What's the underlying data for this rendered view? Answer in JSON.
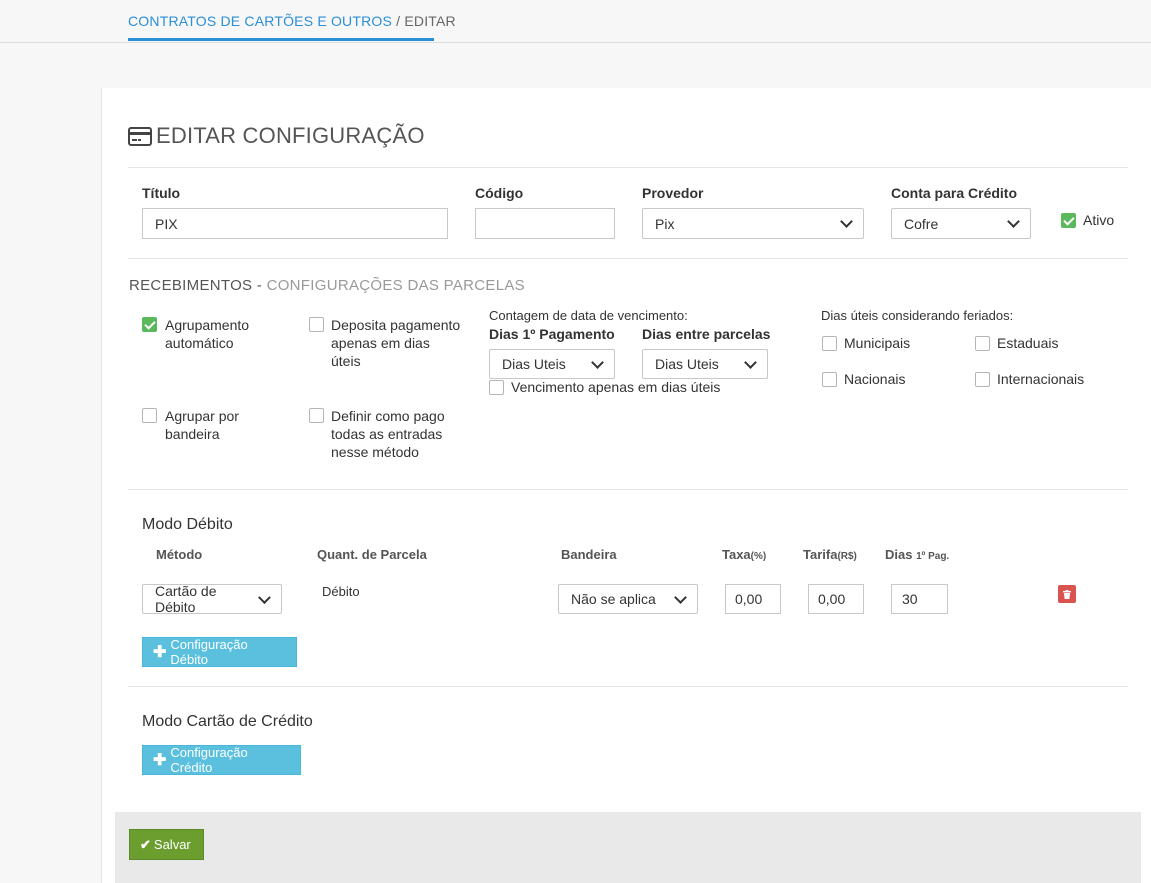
{
  "breadcrumb": {
    "parent": "CONTRATOS DE CARTÕES E OUTROS",
    "separator": " / ",
    "current": "EDITAR"
  },
  "header": {
    "title": "EDITAR CONFIGURAÇÃO",
    "icon": "credit-card-icon"
  },
  "form": {
    "titulo": {
      "label": "Título",
      "value": "PIX"
    },
    "codigo": {
      "label": "Código",
      "value": ""
    },
    "provedor": {
      "label": "Provedor",
      "value": "Pix"
    },
    "conta": {
      "label": "Conta para Crédito",
      "value": "Cofre"
    },
    "ativo": {
      "label": "Ativo",
      "checked": true
    }
  },
  "recebimentos": {
    "title": "RECEBIMENTOS - ",
    "subtitle": "CONFIGURAÇÕES DAS PARCELAS",
    "agrupamento": {
      "label": "Agrupamento automático",
      "checked": true
    },
    "deposita": {
      "label": "Deposita pagamento apenas em dias úteis",
      "checked": false
    },
    "agrupar_bandeira": {
      "label": "Agrupar por bandeira",
      "checked": false
    },
    "definir_pago": {
      "label": "Definir como pago todas as entradas nesse método",
      "checked": false
    },
    "contagem_label": "Contagem de data de vencimento:",
    "dias_primeiro": {
      "label": "Dias 1º Pagamento",
      "value": "Dias Uteis"
    },
    "dias_entre": {
      "label": "Dias entre parcelas",
      "value": "Dias Uteis"
    },
    "vencimento_uteis": {
      "label": "Vencimento apenas em dias úteis",
      "checked": false
    },
    "feriados_label": "Dias úteis considerando feriados:",
    "feriados": {
      "municipais": "Municipais",
      "estaduais": "Estaduais",
      "nacionais": "Nacionais",
      "internacionais": "Internacionais"
    }
  },
  "debito": {
    "title": "Modo Débito",
    "columns": {
      "metodo": "Método",
      "quant": "Quant. de Parcela",
      "bandeira": "Bandeira",
      "taxa": "Taxa",
      "taxa_unit": "(%)",
      "tarifa": "Tarifa",
      "tarifa_unit": "(R$)",
      "dias": "Dias",
      "dias_unit": "1º Pag."
    },
    "row": {
      "metodo": "Cartão de Débito",
      "quant": "Débito",
      "bandeira": "Não se aplica",
      "taxa": "0,00",
      "tarifa": "0,00",
      "dias": "30"
    },
    "add_button": "Configuração Débito"
  },
  "credito": {
    "title": "Modo Cartão de Crédito",
    "add_button": "Configuração Crédito"
  },
  "save_button": "Salvar",
  "colors": {
    "accent": "#2a8fd6",
    "success": "#5cb85c",
    "info": "#5bc0de",
    "danger": "#d9534f",
    "save": "#6b9e2f"
  }
}
